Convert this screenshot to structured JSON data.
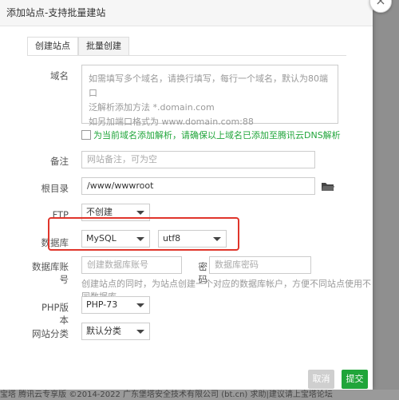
{
  "dialog": {
    "title": "添加站点-支持批量建站",
    "close_symbol": "×"
  },
  "tabs": [
    "创建站点",
    "批量创建"
  ],
  "form": {
    "domain_label": "域名",
    "domain_placeholder_lines": [
      "如需填写多个域名，请换行填写，每行一个域名，默认为80端口",
      "泛解析添加方法 *.domain.com",
      "如另加端口格式为 www.domain.com:88"
    ],
    "dns_checkbox_label": "为当前域名添加解析，请确保以上域名已添加至腾讯云DNS解析",
    "remark_label": "备注",
    "remark_placeholder": "网站备注，可为空",
    "root_label": "根目录",
    "root_value": "/www/wwwroot",
    "ftp_label": "FTP",
    "ftp_value": "不创建",
    "db_label": "数据库",
    "db_value": "MySQL",
    "db_charset": "utf8",
    "db_account_label": "数据库账号",
    "db_account_placeholder": "创建数据库账号",
    "password_label": "密码",
    "password_placeholder": "数据库密码",
    "db_hint": "创建站点的同时，为站点创建一个对应的数据库帐户，方便不同站点使用不同数据库。",
    "php_label": "PHP版本",
    "php_value": "PHP-73",
    "category_label": "网站分类",
    "category_value": "默认分类"
  },
  "buttons": {
    "cancel": "取消",
    "submit": "提交"
  },
  "footer_text": "宝塔 腾讯云专享版 ©2014-2022 广东堡塔安全技术有限公司 (bt.cn)   求助|建议请上宝塔论坛"
}
